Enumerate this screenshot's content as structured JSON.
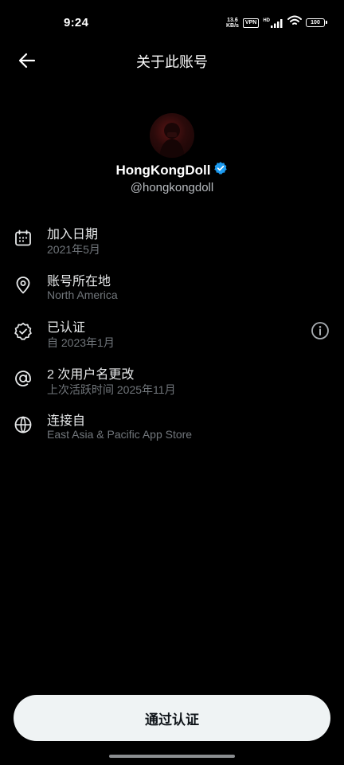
{
  "status_bar": {
    "time": "9:24",
    "net_speed_value": "13.6",
    "net_speed_unit": "KB/s",
    "vpn": "VPN",
    "network_type": "HD",
    "battery": "100"
  },
  "header": {
    "title": "关于此账号",
    "back_icon": "arrow-left-icon"
  },
  "profile": {
    "display_name": "HongKongDoll",
    "handle": "@hongkongdoll",
    "verified_badge_color": "#1d9bf0"
  },
  "info": [
    {
      "icon": "calendar-icon",
      "title": "加入日期",
      "subtitle": "2021年5月"
    },
    {
      "icon": "location-pin-icon",
      "title": "账号所在地",
      "subtitle": "North America"
    },
    {
      "icon": "verified-badge-icon",
      "title": "已认证",
      "subtitle": "自 2023年1月",
      "detail_icon": "info-icon"
    },
    {
      "icon": "at-sign-icon",
      "title": "2 次用户名更改",
      "subtitle": "上次活跃时间 2025年11月"
    },
    {
      "icon": "globe-icon",
      "title": "连接自",
      "subtitle": "East Asia & Pacific App Store"
    }
  ],
  "primary_button": {
    "label": "通过认证"
  },
  "colors": {
    "background": "#000000",
    "primary_text": "#e7e9ea",
    "secondary_text": "#71767b",
    "button_bg": "#eff3f4",
    "button_text": "#0f1419"
  }
}
